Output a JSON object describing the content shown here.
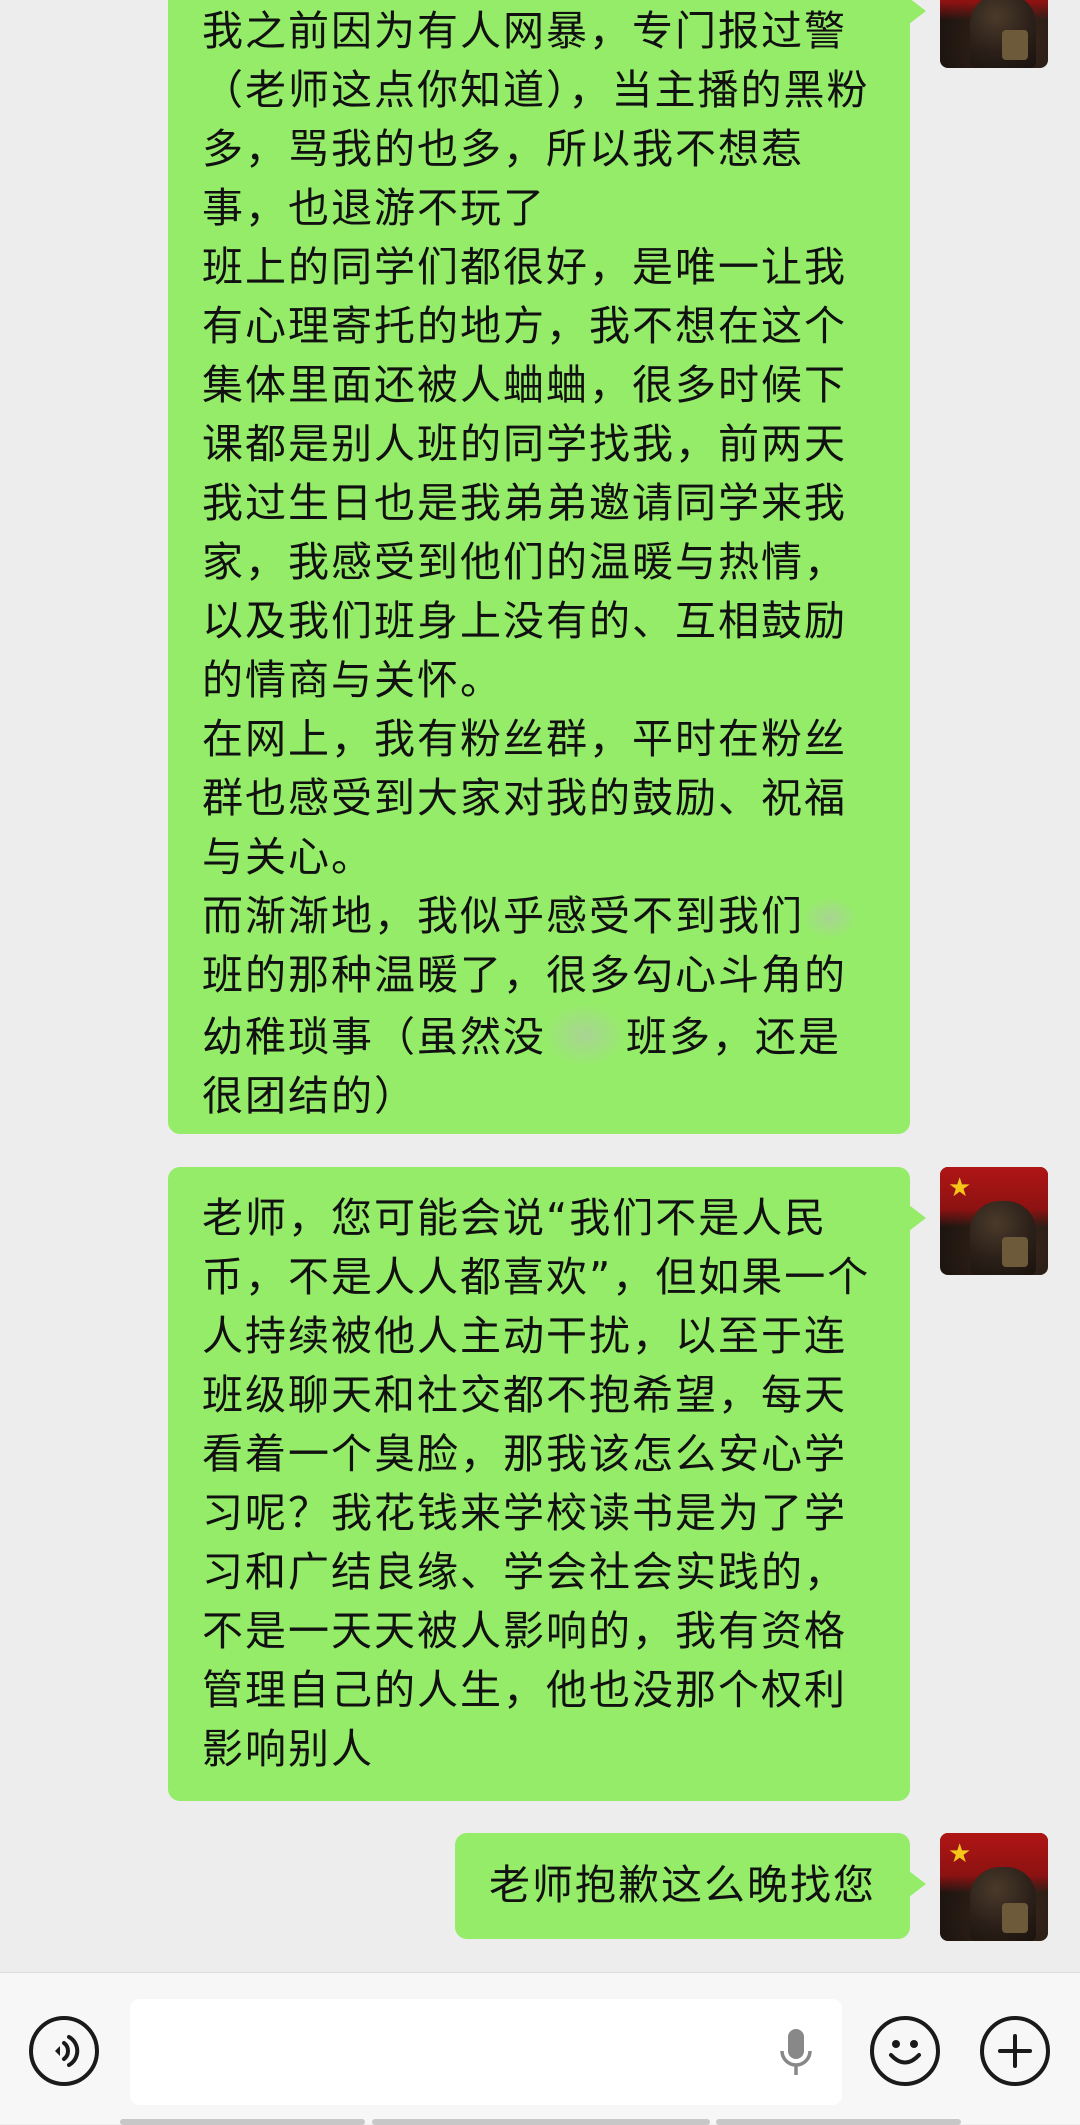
{
  "messages": [
    {
      "text": "我之前因为有人网暴，专门报过警（老师这点你知道），当主播的黑粉多，骂我的也多，所以我不想惹事，也退游不玩了\n班上的同学们都很好，是唯一让我有心理寄托的地方，我不想在这个集体里面还被人蛐蛐，很多时候下课都是别人班的同学找我，前两天我过生日也是我弟弟邀请同学来我家，我感受到他们的温暖与热情，以及我们班身上没有的、互相鼓励的情商与关怀。\n在网上，我有粉丝群，平时在粉丝群也感受到大家对我的鼓励、祝福与关心。\n而渐渐地，我似乎感受不到我们",
      "text_tail_1": "班的那种温暖了，很多勾心斗角的幼稚琐事（虽然没",
      "text_tail_2": "班多，还是很团结的）"
    },
    {
      "text": "老师，您可能会说“我们不是人民币，不是人人都喜欢”，但如果一个人持续被他人主动干扰，以至于连班级聊天和社交都不抱希望，每天看着一个臭脸，那我该怎么安心学习呢？我花钱来学校读书是为了学习和广结良缘、学会社会实践的，不是一天天被人影响的，我有资格管理自己的人生，他也没那个权利影响别人"
    },
    {
      "text": "老师抱歉这么晚找您"
    }
  ],
  "colors": {
    "bubble": "#95ec69",
    "background": "#ededed",
    "input_bar": "#f7f7f7"
  },
  "icons": {
    "voice": "voice-mode-icon",
    "mic": "microphone-icon",
    "emoji": "emoji-icon",
    "plus": "plus-icon"
  }
}
